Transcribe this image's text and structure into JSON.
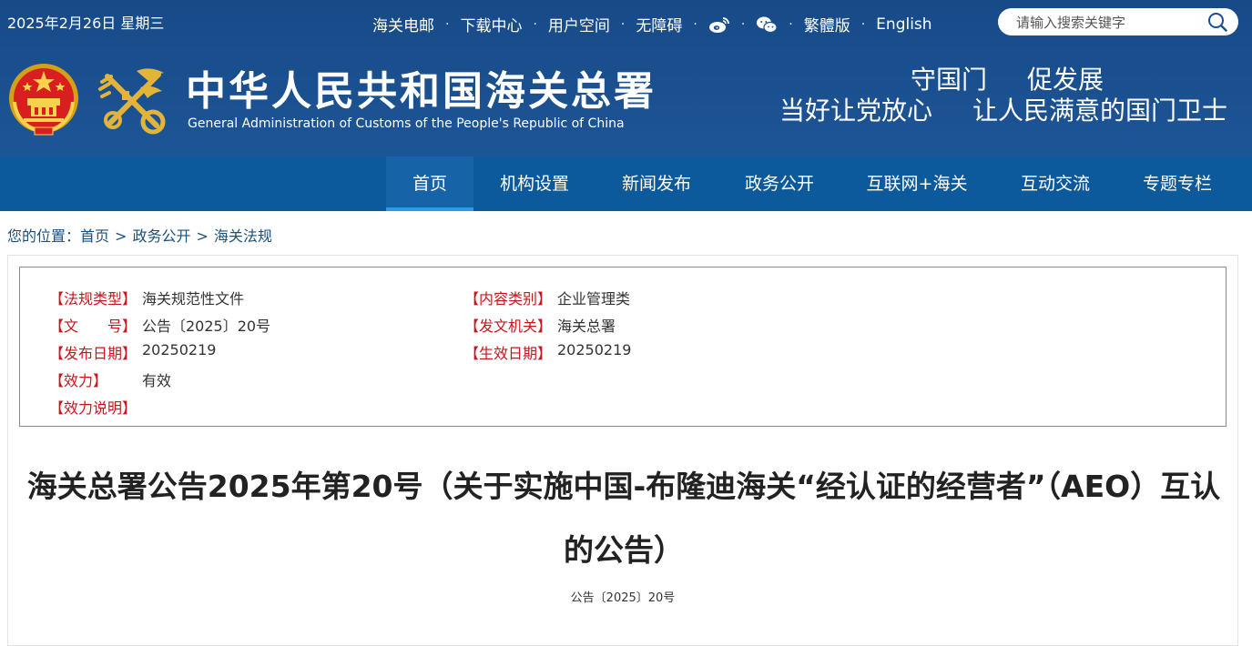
{
  "topbar": {
    "date": "2025年2月26日 星期三",
    "links": [
      "海关电邮",
      "下载中心",
      "用户空间",
      "无障碍"
    ],
    "lang_traditional": "繁體版",
    "lang_english": "English",
    "separator": "·",
    "search_placeholder": "请输入搜索关键字"
  },
  "header": {
    "title": "中华人民共和国海关总署",
    "subtitle": "General Administration of Customs of the People's Republic of China",
    "slogan_line1": [
      "守国门",
      "促发展"
    ],
    "slogan_line2": [
      "当好让党放心",
      "让人民满意的国门卫士"
    ]
  },
  "nav": [
    "首页",
    "机构设置",
    "新闻发布",
    "政务公开",
    "互联网+海关",
    "互动交流",
    "专题专栏"
  ],
  "breadcrumb": {
    "prefix": "您的位置：",
    "items": [
      "首页",
      "政务公开",
      "海关法规"
    ],
    "sep": ">"
  },
  "meta": {
    "regulation_type_label": "【法规类型】",
    "regulation_type": "海关规范性文件",
    "content_category_label": "【内容类别】",
    "content_category": "企业管理类",
    "doc_number_label": "【文　　号】",
    "doc_number": "公告〔2025〕20号",
    "issuing_authority_label": "【发文机关】",
    "issuing_authority": "海关总署",
    "publish_date_label": "【发布日期】",
    "publish_date": "20250219",
    "effective_date_label": "【生效日期】",
    "effective_date": "20250219",
    "validity_label": "【效力】",
    "validity": "有效",
    "validity_note_label": "【效力说明】"
  },
  "document": {
    "title": "海关总署公告2025年第20号（关于实施中国-布隆迪海关“经认证的经营者”（AEO）互认的公告）",
    "number": "公告〔2025〕20号"
  },
  "colors": {
    "header_bg": "#1a4f8e",
    "nav_bg": "#0c5a9c",
    "nav_active_underline": "#2a9de6",
    "label_red": "#c8161d",
    "breadcrumb_blue": "#19507e"
  },
  "icons": [
    "weibo-icon",
    "wechat-icon",
    "search-icon",
    "national-emblem-icon",
    "customs-emblem-icon"
  ]
}
